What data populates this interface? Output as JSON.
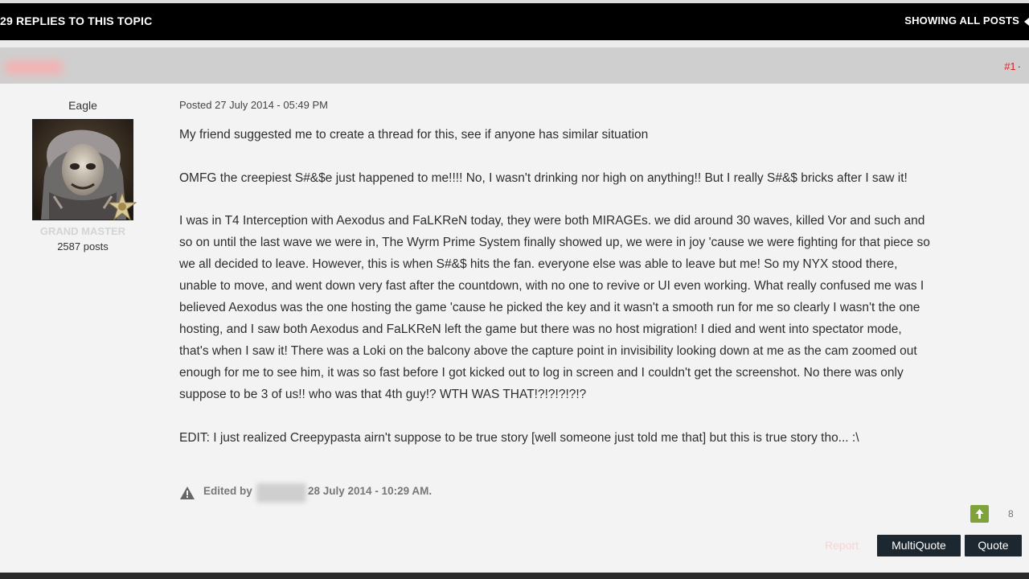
{
  "topbar": {
    "replies_label": "29 REPLIES TO THIS TOPIC",
    "showing_label": "SHOWING ALL POSTS"
  },
  "post": {
    "number": "#1",
    "author": {
      "name": "Eagle",
      "rank": "GRAND MASTER",
      "posts": "2587 posts"
    },
    "posted": "Posted 27 July 2014 - 05:49 PM",
    "paragraphs": [
      [
        "My friend suggested me to create a thread for this, see if anyone has similar situation"
      ],
      [
        "OMFG the creepiest S#&$e just happened to me!!!! No, I wasn't drinking nor high on anything!! But I really S#&$ bricks after I saw it!"
      ],
      [
        "I was in T4 Interception with Aexodus and FaLKReN today, they were both MIRAGEs. we did around 30 waves, killed Vor and such and",
        "so on until the last wave we were in, The Wyrm Prime System finally showed up, we were in joy 'cause we were fighting for that piece so",
        "we all decided to leave. However, this is when S#&$ hits the fan. everyone else was able to leave but me! So my NYX stood there,",
        "unable to move, and went down very fast after the countdown, with no one to revive or UI even working. What really confused me was I",
        "believed Aexodus was the one hosting the game 'cause he picked the key and it wasn't a smooth run for me so clearly I wasn't the one",
        "hosting, and I saw both Aexodus and FaLKReN left the game but there was no host migration! I died and went into spectator mode,",
        "that's when I saw it! There was a Loki on the balcony above the capture point in invisibility looking down at me as the cam zoomed out",
        "enough for me to see him, it was so fast before I got kicked out to log in screen and I couldn't get the screenshot. No there was only",
        "suppose to be 3 of us!! who was that 4th guy!? WTH WAS THAT!?!?!?!?!?"
      ],
      [
        "EDIT: I just realized Creepypasta airn't suppose to be true story [well someone just told me that] but this is true story tho... :\\"
      ]
    ],
    "edited_label": "Edited by",
    "edited_date": "28 July 2014 - 10:29 AM.",
    "rep_count": "8",
    "actions": {
      "report": "Report",
      "multiquote": "MultiQuote",
      "quote": "Quote"
    }
  },
  "colors": {
    "topbar_bg": "#000000",
    "post_header_bg": "#cfcfcf",
    "button_bg": "#1c2730",
    "rep_green": "#7fa33a",
    "post_number": "#d0282b"
  }
}
